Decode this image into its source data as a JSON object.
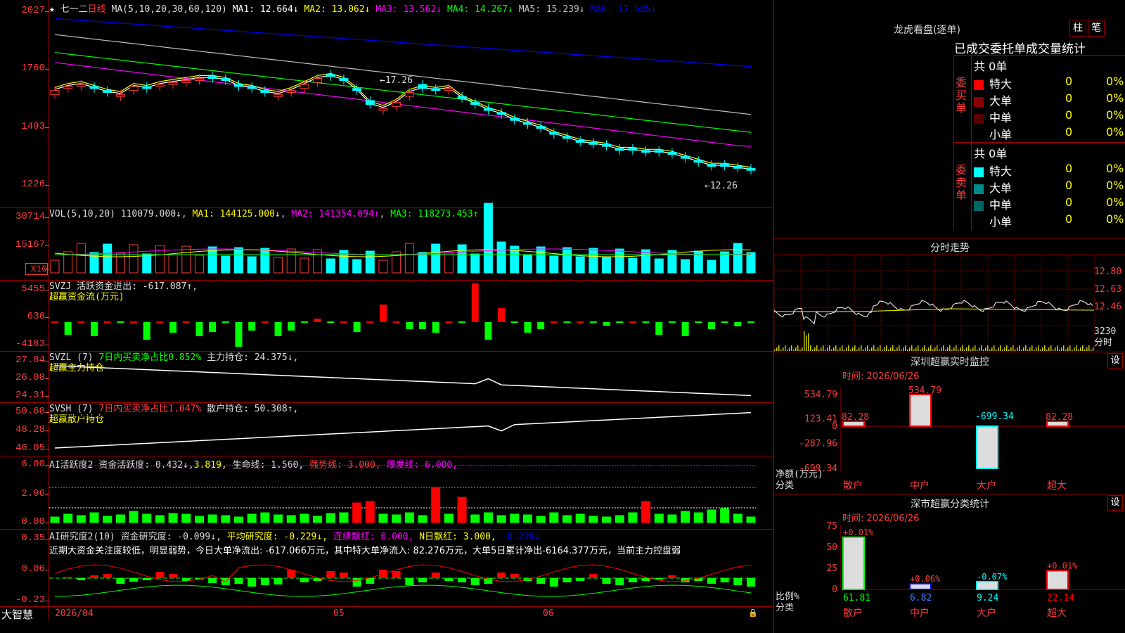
{
  "stock": {
    "name": "七一二",
    "period": "日线",
    "ma_label": "MA(5,10,20,30,60,120)",
    "ma_values": [
      {
        "label": "MA1:",
        "value": "12.664↓",
        "color": "#ffffff"
      },
      {
        "label": "MA2:",
        "value": "13.062↓",
        "color": "#ffff00"
      },
      {
        "label": "MA3:",
        "value": "13.562↓",
        "color": "#ff00ff"
      },
      {
        "label": "MA4:",
        "value": "14.267↓",
        "color": "#00ff00"
      },
      {
        "label": "MA5:",
        "value": "15.239↓",
        "color": "#c0c0c0"
      },
      {
        "label": "MA6:",
        "value": "17.585↓",
        "color": "#0000ff"
      }
    ],
    "high_mark": "17.26",
    "low_mark": "12.26",
    "price_axis": [
      "2027",
      "1760",
      "1493",
      "1226"
    ]
  },
  "vol": {
    "legend": "VOL(5,10,20)",
    "value": "110079.000↓",
    "ma1": "MA1: 144125.000↓",
    "ma2": "MA2: 141354.094↑",
    "ma3": "MA3: 118273.453↑",
    "axis": [
      "30714",
      "15167",
      "X10"
    ]
  },
  "svzj": {
    "title": "SVZJ  活跃资金进出: -617.087↑,",
    "sub": "超赢资金流(万元)",
    "axis": [
      "5455",
      "636",
      "-4183"
    ]
  },
  "svzl": {
    "title_a": "SVZL (7)",
    "title_b": "7日内买卖净占比0.852%",
    "title_c": "主力持仓: 24.375↓,",
    "sub": "超赢主力持仓",
    "axis": [
      "27.84",
      "26.08",
      "24.31"
    ]
  },
  "svsh": {
    "title_a": "SVSH (7)",
    "title_b": "7日内买卖净占比1.047%",
    "title_c": "散户持仓: 50.308↑,",
    "sub": "超赢散户持仓",
    "axis": [
      "50.60",
      "48.28",
      "46.05"
    ]
  },
  "ai1": {
    "title_a": "AI活跃度2",
    "title_b": "资金活跃度: 0.432↓,",
    "title_c": "3.819,",
    "title_d": "生命线: 1.560,",
    "title_e": "强势线: 3.000,",
    "title_f": "爆发线: 6.000,",
    "axis": [
      "6.00",
      "2.96",
      "0.00"
    ]
  },
  "ai2": {
    "title_a": "AI研究度2(10)",
    "title_b": "资金研究度: -0.099↓,",
    "title_c": "平均研究度: -0.229↓,",
    "title_d": "连续飘红: 0.000,",
    "title_e": "N日飘红: 3.000,",
    "title_f": "-0.229↓",
    "text": "近期大资金关注度较低，明显弱势，今日大单净流出: -617.066万元，其中特大单净流入: 82.276万元，大单5日累计净出-6164.377万元，当前主力控盘弱",
    "axis": [
      "0.35",
      "0.06",
      "-0.23"
    ]
  },
  "footer": {
    "brand": "大智慧",
    "date": "2026/04",
    "m05": "05",
    "m06": "06"
  },
  "panel": {
    "title": "龙虎看盘(逐单)",
    "btn1": "柱",
    "btn2": "笔",
    "subtitle": "已成交委托单成交量统计",
    "buy_label": "委买单",
    "sell_label": "委卖单",
    "buy_total": "共 0单",
    "sell_total": "共 0单",
    "buy_rows": [
      {
        "name": "特大",
        "count": "0",
        "pct": "0%",
        "color": "#ff0000"
      },
      {
        "name": "大单",
        "count": "0",
        "pct": "0%",
        "color": "#8b0000"
      },
      {
        "name": "中单",
        "count": "0",
        "pct": "0%",
        "color": "#5a0000"
      },
      {
        "name": "小单",
        "count": "0",
        "pct": "0%",
        "color": "#000000"
      }
    ],
    "sell_rows": [
      {
        "name": "特大",
        "count": "0",
        "pct": "0%",
        "color": "#00ffff"
      },
      {
        "name": "大单",
        "count": "0",
        "pct": "0%",
        "color": "#008b8b"
      },
      {
        "name": "中单",
        "count": "0",
        "pct": "0%",
        "color": "#006666"
      },
      {
        "name": "小单",
        "count": "0",
        "pct": "0%",
        "color": "#000000"
      }
    ],
    "minute_title": "分时走势",
    "minute_axis": [
      "12.80",
      "12.63",
      "12.46",
      "3230",
      "分时"
    ],
    "monitor_title": "深圳超赢实时监控",
    "monitor_btn": "设",
    "monitor_time": "时间: 2026/06/26",
    "monitor_axis": [
      "534.79",
      "123.41",
      "0",
      "-287.96",
      "-699.34"
    ],
    "monitor_ylabel": "净额(万元)",
    "monitor_xlabel": "分类",
    "classify_title": "深市超赢分类统计",
    "classify_btn": "设",
    "classify_time": "时间: 2026/06/26",
    "classify_axis": [
      "75",
      "50",
      "25",
      "0"
    ],
    "classify_ylabel": "比例%",
    "classify_xlabel": "分类"
  },
  "chart_data": [
    {
      "type": "bar",
      "title": "深圳超赢实时监控",
      "categories": [
        "散户",
        "中户",
        "大户",
        "超大"
      ],
      "values": [
        82.28,
        534.79,
        -699.34,
        82.28
      ],
      "value_labels": [
        "82.28",
        "534.79",
        "-699.34",
        "82.28"
      ],
      "ylabel": "净额(万元)",
      "ylim": [
        -699.34,
        534.79
      ],
      "colors": [
        "#ff0000",
        "#ff0000",
        "#00ffff",
        "#ff0000"
      ]
    },
    {
      "type": "bar",
      "title": "深市超赢分类统计",
      "categories": [
        "散户",
        "中户",
        "大户",
        "超大"
      ],
      "values": [
        61.81,
        6.82,
        9.24,
        22.14
      ],
      "value_labels": [
        "61.81",
        "6.82",
        "9.24",
        "22.14"
      ],
      "change_labels": [
        "+0.01%",
        "+0.06%",
        "-0.07%",
        "+0.01%"
      ],
      "ylabel": "比例%",
      "ylim": [
        0,
        75
      ],
      "colors": [
        "#00ff00",
        "#0000ff",
        "#00ffff",
        "#ff0000"
      ]
    },
    {
      "type": "line",
      "title": "七一二 日线",
      "close": [
        16.3,
        16.5,
        16.6,
        16.4,
        16.2,
        16.1,
        16.5,
        16.4,
        16.6,
        16.7,
        16.8,
        16.9,
        16.9,
        16.8,
        16.5,
        16.4,
        16.2,
        16.1,
        16.3,
        16.6,
        16.9,
        17.0,
        16.8,
        16.3,
        15.6,
        15.4,
        15.7,
        16.2,
        16.4,
        16.3,
        16.4,
        15.9,
        15.6,
        15.3,
        15.1,
        14.8,
        14.6,
        14.4,
        14.1,
        13.9,
        13.7,
        13.6,
        13.5,
        13.3,
        13.3,
        13.2,
        13.2,
        13.1,
        12.9,
        12.7,
        12.5,
        12.5,
        12.4,
        12.3
      ],
      "open": [
        16.1,
        16.4,
        16.5,
        16.5,
        16.3,
        16.0,
        16.3,
        16.5,
        16.5,
        16.6,
        16.7,
        16.8,
        17.0,
        16.9,
        16.6,
        16.5,
        16.3,
        16.0,
        16.2,
        16.4,
        16.7,
        17.1,
        16.9,
        16.4,
        15.8,
        15.3,
        15.5,
        16.0,
        16.6,
        16.4,
        16.3,
        16.0,
        15.7,
        15.4,
        15.2,
        14.9,
        14.7,
        14.5,
        14.2,
        14.0,
        13.8,
        13.7,
        13.6,
        13.4,
        13.4,
        13.3,
        13.3,
        13.2,
        13.0,
        12.8,
        12.6,
        12.6,
        12.5,
        12.4
      ],
      "ylim": [
        12.26,
        20.27
      ]
    }
  ]
}
